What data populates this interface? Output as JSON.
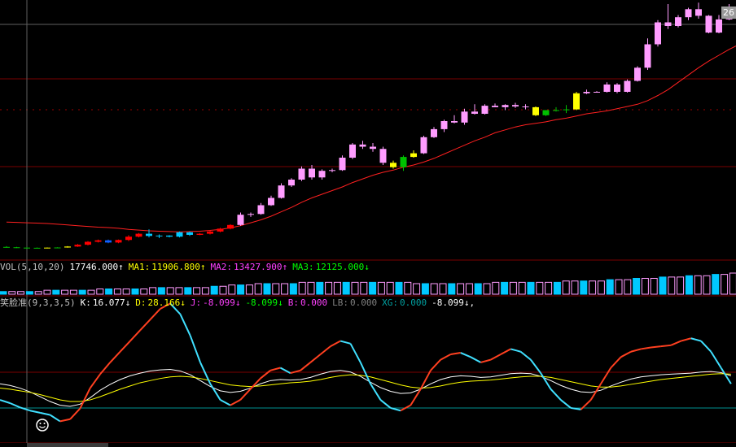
{
  "price_panel": {
    "price_tag": "26"
  },
  "volume_panel": {
    "name": "VOL(5,10,20)",
    "vol_value": "17746.000↑",
    "ma1_label": "MA1:",
    "ma1_value": "11906.800↑",
    "ma2_label": "MA2:",
    "ma2_value": "13427.900↑",
    "ma3_label": "MA3:",
    "ma3_value": "12125.000↓"
  },
  "kdj_panel": {
    "name": "笑脸准(9,3,3,5)",
    "k_label": "K:",
    "k_value": "16.077↓",
    "d_label": "D:",
    "d_value": "28.166↓",
    "j_label": "J:",
    "j_value": "-8.099↓",
    "j2_value": "-8.099↓",
    "b_label": "B:",
    "b_value": "0.000",
    "lb_label": "LB:",
    "lb_value": "0.000",
    "xg_label": "XG:",
    "xg_value": "0.000",
    "last_value": "-8.099↓,",
    "signal_icon": "smiley-face-icon"
  },
  "colors": {
    "background": "#000000",
    "up_candle": "#ff9cff",
    "down_candle": "#ff0000",
    "cyan_candle": "#00c8ff",
    "yellow_candle": "#ffff00",
    "green_candle": "#00c000",
    "ma_line": "#ff2020",
    "grid": "#7a0000",
    "k_line": "#ffffff",
    "d_line": "#ffff00",
    "j_up": "#ff4020",
    "j_down": "#40e0ff"
  },
  "chart_data": [
    {
      "type": "candlestick",
      "title": "",
      "price_tag": "26",
      "candles": [
        [
          1.8,
          1.9,
          1.7,
          1.75,
          "green"
        ],
        [
          1.75,
          1.8,
          1.65,
          1.7,
          "green"
        ],
        [
          1.7,
          1.75,
          1.62,
          1.68,
          "green"
        ],
        [
          1.68,
          1.72,
          1.6,
          1.66,
          "green"
        ],
        [
          1.66,
          1.72,
          1.6,
          1.7,
          "yellow"
        ],
        [
          1.7,
          1.75,
          1.65,
          1.72,
          "green"
        ],
        [
          1.72,
          1.9,
          1.7,
          1.85,
          "yellow"
        ],
        [
          1.85,
          2.2,
          1.8,
          2.1,
          "red"
        ],
        [
          2.1,
          2.6,
          2.0,
          2.5,
          "red"
        ],
        [
          2.5,
          2.8,
          2.4,
          2.7,
          "red"
        ],
        [
          2.7,
          2.8,
          2.3,
          2.4,
          "blue"
        ],
        [
          2.4,
          2.8,
          2.3,
          2.75,
          "red"
        ],
        [
          2.75,
          3.4,
          2.6,
          3.2,
          "red"
        ],
        [
          3.2,
          3.7,
          3.1,
          3.6,
          "red"
        ],
        [
          3.6,
          4.2,
          3.1,
          3.3,
          "cyan"
        ],
        [
          3.3,
          3.5,
          3.0,
          3.35,
          "cyan"
        ],
        [
          3.35,
          3.4,
          3.1,
          3.2,
          "cyan"
        ],
        [
          3.2,
          3.9,
          3.1,
          3.8,
          "cyan"
        ],
        [
          3.8,
          3.9,
          3.3,
          3.45,
          "cyan"
        ],
        [
          3.45,
          3.7,
          3.4,
          3.6,
          "red"
        ],
        [
          3.6,
          4.0,
          3.5,
          3.9,
          "red"
        ],
        [
          3.9,
          4.4,
          3.8,
          4.3,
          "red"
        ],
        [
          4.3,
          4.9,
          4.2,
          4.8,
          "red"
        ],
        [
          4.8,
          6.5,
          4.7,
          6.2,
          "pink"
        ],
        [
          6.2,
          6.5,
          5.9,
          6.3,
          "pink"
        ],
        [
          6.3,
          7.8,
          6.2,
          7.5,
          "pink"
        ],
        [
          7.5,
          8.8,
          7.4,
          8.5,
          "pink"
        ],
        [
          8.5,
          10.5,
          8.4,
          10.2,
          "pink"
        ],
        [
          10.2,
          11.2,
          10.0,
          11.0,
          "pink"
        ],
        [
          11.0,
          12.8,
          10.8,
          12.5,
          "pink"
        ],
        [
          12.5,
          13.0,
          11.0,
          11.3,
          "pink"
        ],
        [
          11.3,
          12.4,
          11.0,
          12.2,
          "pink"
        ],
        [
          12.2,
          12.5,
          12.0,
          12.3,
          "pink"
        ],
        [
          12.3,
          14.3,
          12.2,
          14.0,
          "pink"
        ],
        [
          14.0,
          16.0,
          13.8,
          15.8,
          "pink"
        ],
        [
          15.8,
          16.3,
          15.2,
          15.5,
          "pink"
        ],
        [
          15.5,
          16.0,
          14.8,
          15.2,
          "pink"
        ],
        [
          15.2,
          15.5,
          13.0,
          13.3,
          "pink"
        ],
        [
          13.3,
          13.6,
          12.5,
          12.7,
          "yellow"
        ],
        [
          12.7,
          14.3,
          12.2,
          14.1,
          "green"
        ],
        [
          14.1,
          15.0,
          14.0,
          14.6,
          "yellow"
        ],
        [
          14.6,
          17.0,
          14.5,
          16.8,
          "pink"
        ],
        [
          16.8,
          18.2,
          16.7,
          17.9,
          "pink"
        ],
        [
          17.9,
          19.2,
          17.5,
          19.0,
          "pink"
        ],
        [
          19.0,
          19.8,
          18.7,
          18.8,
          "pink"
        ],
        [
          18.8,
          20.7,
          18.5,
          20.3,
          "pink"
        ],
        [
          20.3,
          21.3,
          19.9,
          20.0,
          "pink"
        ],
        [
          20.0,
          21.3,
          19.9,
          21.1,
          "pink"
        ],
        [
          21.1,
          21.4,
          20.9,
          20.9,
          "pink"
        ],
        [
          20.9,
          21.3,
          20.5,
          21.2,
          "pink"
        ],
        [
          21.2,
          21.5,
          20.8,
          21.0,
          "pink"
        ],
        [
          21.0,
          21.3,
          20.6,
          20.9,
          "pink"
        ],
        [
          20.9,
          21.0,
          19.7,
          19.8,
          "yellow"
        ],
        [
          19.8,
          20.5,
          19.7,
          20.5,
          "green"
        ],
        [
          20.5,
          20.9,
          20.3,
          20.5,
          "green"
        ],
        [
          20.5,
          21.2,
          20.1,
          20.6,
          "green"
        ],
        [
          20.6,
          23.0,
          20.5,
          22.8,
          "yellow"
        ],
        [
          22.8,
          23.3,
          22.7,
          23.0,
          "pink"
        ],
        [
          23.0,
          23.1,
          22.9,
          23.0,
          "pink"
        ],
        [
          23.0,
          24.3,
          22.9,
          24.0,
          "pink"
        ],
        [
          24.0,
          24.2,
          22.8,
          23.0,
          "pink"
        ],
        [
          23.0,
          24.7,
          22.9,
          24.5,
          "pink"
        ],
        [
          24.5,
          26.5,
          24.4,
          26.3,
          "pink"
        ],
        [
          26.3,
          30.3,
          26.0,
          29.5,
          "pink"
        ],
        [
          29.5,
          32.8,
          29.2,
          32.5,
          "pink"
        ],
        [
          32.5,
          35.0,
          31.6,
          32.0,
          "pink"
        ],
        [
          32.0,
          33.5,
          31.8,
          33.2,
          "pink"
        ],
        [
          33.2,
          34.5,
          32.8,
          34.3,
          "pink"
        ],
        [
          34.3,
          35.2,
          33.0,
          33.4,
          "pink"
        ],
        [
          33.4,
          33.5,
          31.0,
          31.1,
          "pink"
        ],
        [
          31.1,
          33.5,
          31.0,
          32.9,
          "pink"
        ],
        [
          32.9,
          35.0,
          32.8,
          34.5,
          "pink"
        ],
        [
          34.5,
          35.2,
          31.5,
          31.7,
          "pink"
        ]
      ],
      "ma": [
        5.2,
        5.15,
        5.1,
        5.05,
        5.0,
        4.9,
        4.8,
        4.7,
        4.6,
        4.5,
        4.45,
        4.35,
        4.2,
        4.1,
        4.0,
        3.95,
        3.9,
        3.85,
        3.9,
        3.95,
        4.05,
        4.2,
        4.4,
        4.7,
        5.1,
        5.5,
        6.0,
        6.6,
        7.2,
        7.9,
        8.5,
        9.0,
        9.5,
        10.0,
        10.6,
        11.1,
        11.6,
        12.0,
        12.3,
        12.7,
        13.0,
        13.4,
        13.9,
        14.5,
        15.1,
        15.7,
        16.3,
        16.8,
        17.4,
        17.8,
        18.2,
        18.5,
        18.7,
        18.9,
        19.2,
        19.4,
        19.7,
        20.0,
        20.2,
        20.4,
        20.7,
        21.0,
        21.3,
        21.8,
        22.5,
        23.3,
        24.3,
        25.3,
        26.3,
        27.2,
        28.0,
        28.8,
        29.5
      ]
    },
    {
      "type": "bar",
      "title": "VOL(5,10,20)",
      "values": [
        2,
        2,
        2,
        2,
        2,
        3,
        3,
        3,
        3,
        3,
        3,
        4,
        4,
        4,
        4,
        4,
        4,
        5,
        5,
        5,
        5,
        5,
        5,
        5,
        6,
        6,
        7,
        7,
        7,
        8,
        8,
        8,
        8,
        8,
        9,
        9,
        9,
        9,
        9,
        9,
        9,
        9,
        9,
        9,
        9,
        9,
        9,
        8,
        8,
        8,
        8,
        8,
        8,
        8,
        8,
        8,
        9,
        9,
        9,
        9,
        9,
        9,
        9,
        9,
        10,
        10,
        10,
        10,
        10,
        11,
        11,
        11,
        12,
        12,
        12,
        13,
        13,
        13,
        14,
        14,
        14,
        15,
        15,
        16
      ]
    },
    {
      "type": "line",
      "title": "笑脸准(9,3,3,5)",
      "series_values": {
        "K": [
          60,
          57,
          52,
          45,
          36,
          27,
          20,
          18,
          22,
          34,
          48,
          59,
          68,
          75,
          80,
          84,
          86,
          87,
          84,
          77,
          66,
          55,
          47,
          44,
          46,
          52,
          60,
          66,
          68,
          67,
          68,
          72,
          78,
          83,
          85,
          82,
          74,
          63,
          53,
          46,
          42,
          43,
          50,
          60,
          68,
          73,
          75,
          74,
          72,
          73,
          76,
          79,
          80,
          79,
          74,
          66,
          57,
          50,
          45,
          44,
          48,
          56,
          63,
          69,
          73,
          75,
          77,
          78,
          79,
          80,
          82,
          83,
          81,
          75
        ],
        "D": [
          52,
          50,
          47,
          44,
          40,
          35,
          30,
          27,
          27,
          30,
          36,
          43,
          50,
          56,
          62,
          66,
          70,
          73,
          74,
          73,
          70,
          66,
          62,
          58,
          56,
          55,
          56,
          58,
          60,
          62,
          63,
          65,
          68,
          72,
          75,
          77,
          76,
          73,
          68,
          63,
          58,
          54,
          52,
          53,
          56,
          60,
          63,
          65,
          66,
          67,
          69,
          71,
          73,
          74,
          74,
          72,
          68,
          64,
          60,
          56,
          54,
          54,
          56,
          59,
          62,
          65,
          68,
          70,
          72,
          74,
          76,
          78,
          79,
          78
        ],
        "J": [
          30,
          24,
          16,
          10,
          6,
          2,
          -10,
          -6,
          14,
          52,
          78,
          100,
          120,
          140,
          160,
          180,
          200,
          210,
          190,
          150,
          100,
          60,
          30,
          20,
          30,
          50,
          70,
          85,
          90,
          80,
          85,
          100,
          115,
          130,
          140,
          135,
          100,
          60,
          30,
          15,
          10,
          20,
          50,
          85,
          105,
          115,
          118,
          110,
          100,
          105,
          115,
          125,
          120,
          105,
          80,
          50,
          30,
          15,
          12,
          30,
          60,
          90,
          110,
          120,
          125,
          128,
          130,
          132,
          140,
          145,
          140,
          120,
          90,
          60
        ]
      }
    }
  ]
}
